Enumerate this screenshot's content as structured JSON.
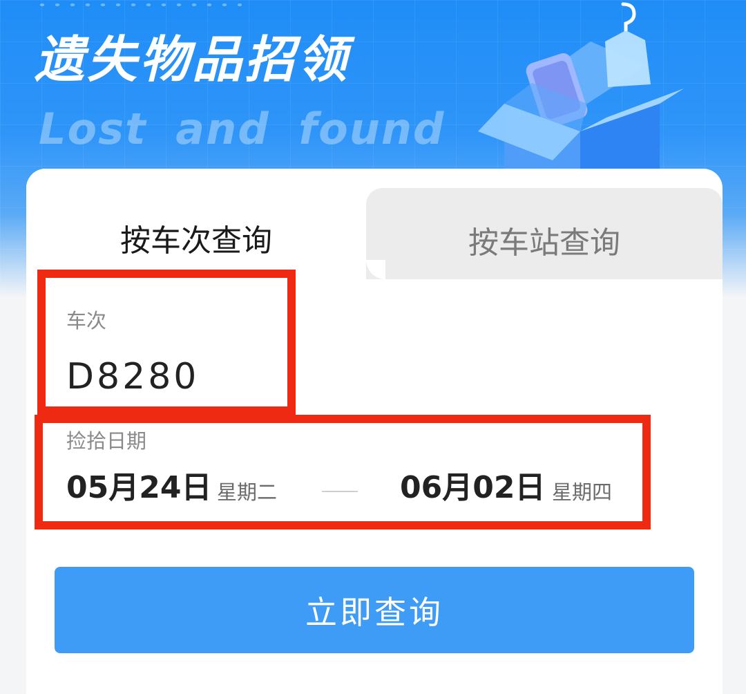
{
  "banner": {
    "title": "遗失物品招领",
    "subtitle": "Lost and found"
  },
  "tabs": [
    {
      "label": "按车次查询",
      "active": true
    },
    {
      "label": "按车站查询",
      "active": false
    }
  ],
  "train_field": {
    "label": "车次",
    "value": "D8280"
  },
  "date_field": {
    "label": "捡拾日期",
    "start_date": "05月24日",
    "start_weekday": "星期二",
    "end_date": "06月02日",
    "end_weekday": "星期四"
  },
  "query_button": {
    "label": "立即查询"
  },
  "colors": {
    "banner_blue": "#1f8df7",
    "button_blue": "#3f9cf6",
    "highlight_red": "#ef2a12",
    "inactive_tab": "#ececec"
  },
  "icons": {
    "illustration": "open-box-with-phone-and-hanger"
  }
}
